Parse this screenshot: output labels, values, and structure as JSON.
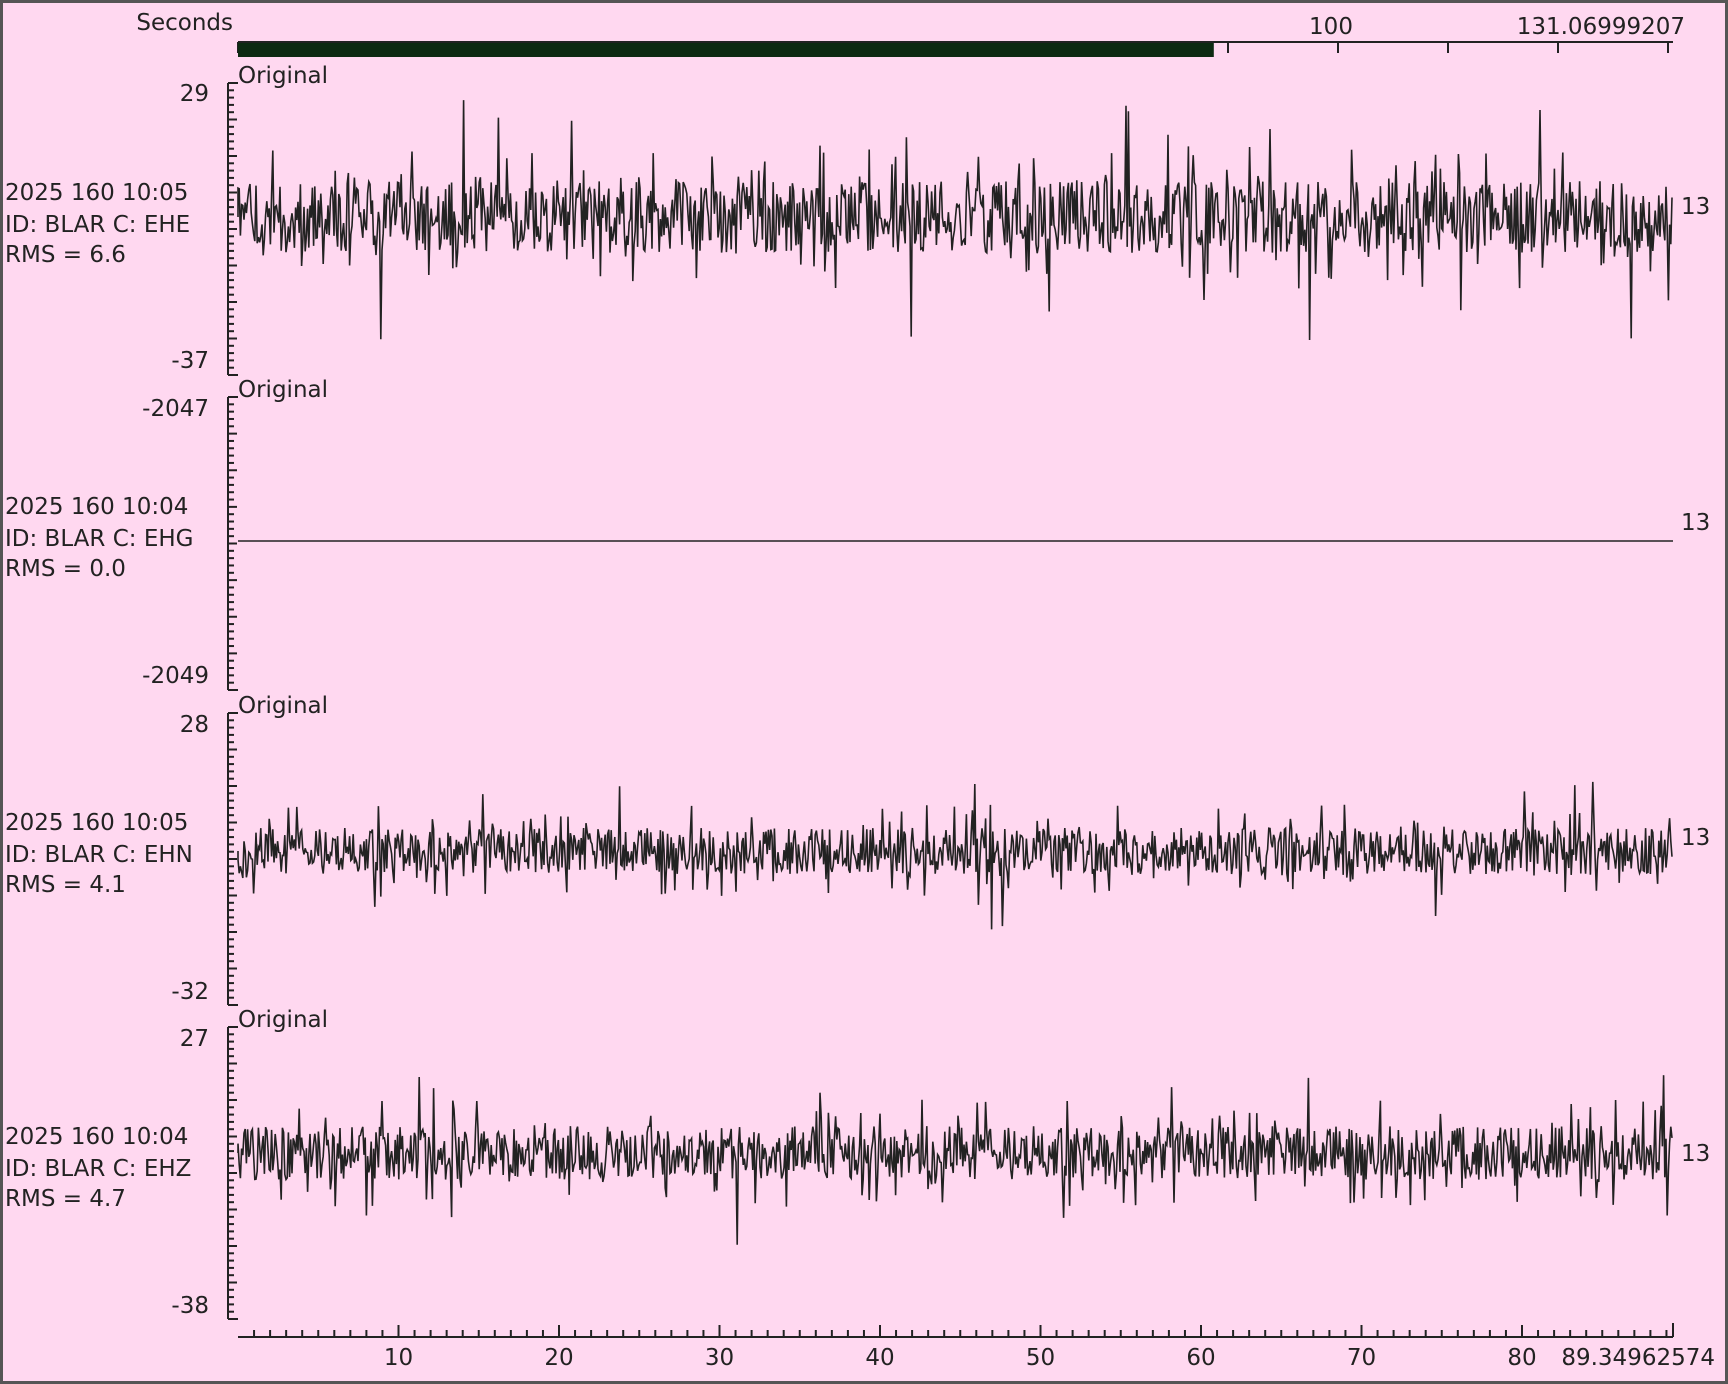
{
  "top_axis": {
    "title": "Seconds",
    "tick_label": "100",
    "end_label": "131.06999207",
    "scroll_fraction": 0.68
  },
  "bottom_axis": {
    "labels": [
      "10",
      "20",
      "30",
      "40",
      "50",
      "60",
      "70",
      "80",
      "89.34962574"
    ]
  },
  "panels": [
    {
      "title": "Original",
      "ymax": "29",
      "ymin": "-37",
      "time": "2025 160 10:05",
      "id": "ID: BLAR C: EHE",
      "rms": "RMS = 6.6",
      "gain": "13",
      "noise": 1.0
    },
    {
      "title": "Original",
      "ymax": "-2047",
      "ymin": "-2049",
      "time": "2025 160 10:04",
      "id": "ID: BLAR C: EHG",
      "rms": "RMS = 0.0",
      "gain": "13",
      "noise": 0.0
    },
    {
      "title": "Original",
      "ymax": "28",
      "ymin": "-32",
      "time": "2025 160 10:05",
      "id": "ID: BLAR C: EHN",
      "rms": "RMS = 4.1",
      "gain": "13",
      "noise": 0.7
    },
    {
      "title": "Original",
      "ymax": "27",
      "ymin": "-38",
      "time": "2025 160 10:04",
      "id": "ID: BLAR C: EHZ",
      "rms": "RMS = 4.7",
      "gain": "13",
      "noise": 0.75
    }
  ],
  "colors": {
    "background": "#ffd8f0",
    "trace": "#222222",
    "scrollbar": "#0d2a12"
  }
}
